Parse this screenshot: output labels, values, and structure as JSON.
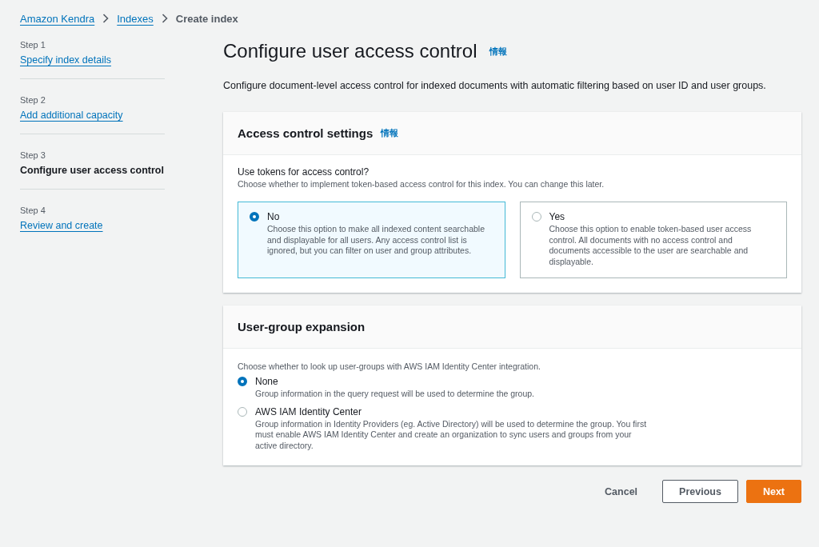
{
  "breadcrumb": [
    {
      "label": "Amazon Kendra",
      "kind": "link"
    },
    {
      "label": "Indexes",
      "kind": "link"
    },
    {
      "label": "Create index",
      "kind": "current"
    }
  ],
  "steps": [
    {
      "step": "Step 1",
      "label": "Specify index details",
      "selected": false
    },
    {
      "step": "Step 2",
      "label": "Add additional capacity",
      "selected": false
    },
    {
      "step": "Step 3",
      "label": "Configure user access control",
      "selected": true
    },
    {
      "step": "Step 4",
      "label": "Review and create",
      "selected": false
    }
  ],
  "page": {
    "title": "Configure user access control",
    "info": "情報",
    "description": "Configure document-level access control for indexed documents with automatic filtering based on user ID and user groups."
  },
  "access_control": {
    "title": "Access control settings",
    "info": "情報",
    "question": "Use tokens for access control?",
    "hint": "Choose whether to implement token-based access control for this index. You can change this later.",
    "options": [
      {
        "label": "No",
        "description": "Choose this option to make all indexed content searchable and displayable for all users. Any access control list is ignored, but you can filter on user and group attributes.",
        "selected": true
      },
      {
        "label": "Yes",
        "description": "Choose this option to enable token-based user access control. All documents with no access control and documents accessible to the user are searchable and displayable.",
        "selected": false
      }
    ]
  },
  "group_expansion": {
    "title": "User-group expansion",
    "hint": "Choose whether to look up user-groups with AWS IAM Identity Center integration.",
    "options": [
      {
        "label": "None",
        "description": "Group information in the query request will be used to determine the group.",
        "selected": true
      },
      {
        "label": "AWS IAM Identity Center",
        "description": "Group information in Identity Providers (eg. Active Directory) will be used to determine the group. You first must enable AWS IAM Identity Center and create an organization to sync users and groups from your active directory.",
        "selected": false
      }
    ]
  },
  "buttons": [
    {
      "label": "Cancel",
      "kind": "link"
    },
    {
      "label": "Previous",
      "kind": "normal"
    },
    {
      "label": "Next",
      "kind": "primary"
    }
  ]
}
